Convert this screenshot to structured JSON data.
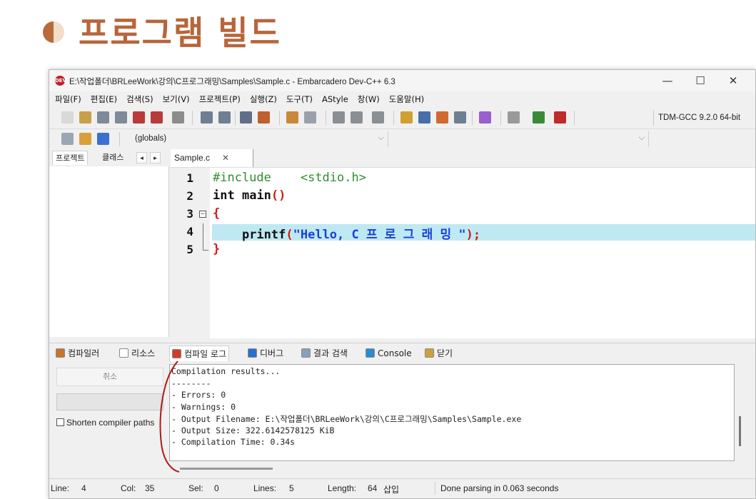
{
  "slide": {
    "title": "프로그램 빌드"
  },
  "window": {
    "app_icon_text": "DEV",
    "title": "E:\\작업폴더\\BRLeeWork\\강의\\C프로그래밍\\Samples\\Sample.c - Embarcadero Dev-C++ 6.3",
    "controls": {
      "minimize": "—",
      "maximize": "☐",
      "close": "✕"
    }
  },
  "menu": [
    "파일(F)",
    "편집(E)",
    "검색(S)",
    "보기(V)",
    "프로젝트(P)",
    "실행(Z)",
    "도구(T)",
    "AStyle",
    "창(W)",
    "도움말(H)"
  ],
  "toolbar": {
    "compiler": "TDM-GCC 9.2.0 64-bit",
    "scope_combo": "(globals)",
    "combo_arrow": "⌵"
  },
  "left_panel": {
    "tabs": [
      "프로젝트",
      "클래스"
    ],
    "arrows": [
      "◂",
      "▸"
    ]
  },
  "editor": {
    "tab_name": "Sample.c",
    "tab_close": "✕",
    "lines": [
      {
        "num": "1",
        "parts": [
          [
            "#include",
            "kw-pre"
          ],
          [
            "    ",
            ""
          ],
          [
            "<stdio.h>",
            "kw-inc"
          ]
        ]
      },
      {
        "num": "2",
        "parts": [
          [
            "int",
            "kw-type"
          ],
          [
            " ",
            ""
          ],
          [
            "main",
            "fn"
          ],
          [
            "()",
            "punc"
          ]
        ]
      },
      {
        "num": "3",
        "fold": "⊟",
        "parts": [
          [
            "{",
            "punc"
          ]
        ]
      },
      {
        "num": "4",
        "parts": [
          [
            "    ",
            ""
          ],
          [
            "printf",
            "fn"
          ],
          [
            "(",
            "punc"
          ],
          [
            "\"Hello, C 프 로 그 래 밍 \"",
            "str"
          ],
          [
            ");",
            "punc"
          ]
        ]
      },
      {
        "num": "5",
        "parts": [
          [
            "}",
            "punc"
          ]
        ]
      }
    ],
    "current_line_index": 3
  },
  "bottom_tabs": [
    {
      "label": "컴파일러",
      "icon_color": "#c8742a"
    },
    {
      "label": "리소스",
      "icon_color": "#ffffff"
    },
    {
      "label": "컴파일 로그",
      "icon_color": "#d33a2a",
      "active": true
    },
    {
      "label": "디버그",
      "icon_color": "#2b6fd0"
    },
    {
      "label": "결과 검색",
      "icon_color": "#8aa0b8"
    },
    {
      "label": "Console",
      "icon_color": "#2b8ad0"
    },
    {
      "label": "닫기",
      "icon_color": "#c9a23a"
    }
  ],
  "bottom_left": {
    "cancel": "취소",
    "shorten_label": "Shorten compiler paths"
  },
  "log": [
    "Compilation results...",
    "--------",
    "- Errors: 0",
    "- Warnings: 0",
    "- Output Filename: E:\\작업폴더\\BRLeeWork\\강의\\C프로그래밍\\Samples\\Sample.exe",
    "- Output Size: 322.6142578125 KiB",
    "- Compilation Time: 0.34s"
  ],
  "status": {
    "line_label": "Line:",
    "line": "4",
    "col_label": "Col:",
    "col": "35",
    "sel_label": "Sel:",
    "sel": "0",
    "lines_label": "Lines:",
    "lines": "5",
    "length_label": "Length:",
    "length": "64",
    "mode": "삽입",
    "message": "Done parsing in 0.063 seconds"
  },
  "colors": {
    "title": "#b8653a",
    "current_line": "#bfe9f2",
    "annotation": "#b01818"
  }
}
